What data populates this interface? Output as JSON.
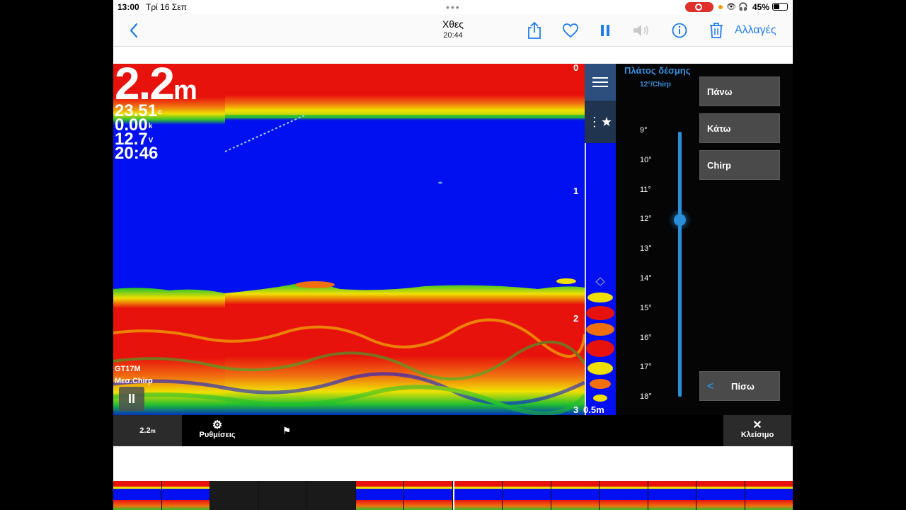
{
  "status_bar": {
    "time": "13:00",
    "date": "Τρί 16 Σεπ",
    "battery": "45%",
    "battery_fraction": 0.45,
    "recording": true
  },
  "toolbar": {
    "back_icon": "chevron-left-icon",
    "title": "Χθες",
    "subtitle": "20:44",
    "edit_label": "Αλλαγές",
    "actions": [
      "share-icon",
      "heart-icon",
      "pause-icon",
      "speaker-muted-icon",
      "info-icon",
      "trash-icon"
    ]
  },
  "sonar": {
    "depth_value": "2.2",
    "depth_unit": "m",
    "temperature": "23.51",
    "temperature_unit": "c",
    "speed": "0.00",
    "speed_unit": "k",
    "voltage": "12.7",
    "voltage_unit": "V",
    "clock": "20:46",
    "transducer": "GT17M",
    "mode": "Μεσ.Chirp",
    "scale_labels": [
      "0",
      "1",
      "2",
      "3"
    ],
    "range_label": "0.5m",
    "colors": {
      "water": "#0010f0",
      "strong_return": "#e8120c",
      "medium_return": "#f0e000",
      "weak_return": "#20c030"
    }
  },
  "panel": {
    "title": "Πλάτος δέσμης",
    "subtitle": "12°/Chirp",
    "ticks": [
      "9°",
      "10°",
      "11°",
      "12°",
      "13°",
      "14°",
      "15°",
      "16°",
      "17°",
      "18°"
    ],
    "selected_value": "12°",
    "buttons": {
      "up": "Πάνω",
      "down": "Κάτω",
      "chirp": "Chirp",
      "back": "Πίσω"
    },
    "accent_color": "#2a8fd9"
  },
  "bottom_bar": {
    "depth": "2.2",
    "depth_unit": "m",
    "settings_label": "Ρυθμίσεις",
    "close_label": "Κλείσιμο"
  }
}
